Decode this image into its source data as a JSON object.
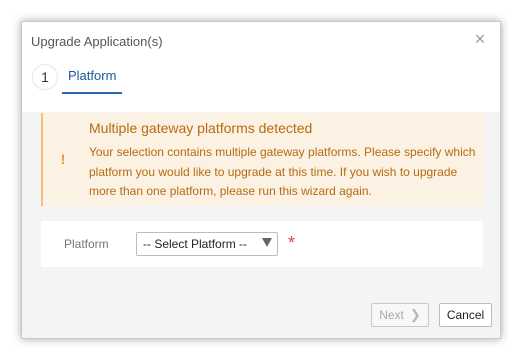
{
  "dialog": {
    "title": "Upgrade Application(s)",
    "close_icon": "close-icon"
  },
  "wizard": {
    "step_number": "1",
    "step_label": "Platform"
  },
  "alert": {
    "icon": "exclamation-icon",
    "title": "Multiple gateway platforms detected",
    "message": "Your selection contains multiple gateway platforms. Please specify which platform you would like to upgrade at this time. If you wish to upgrade more than one platform, please run this wizard again.",
    "color_text": "#b66b12",
    "color_bg": "#fbf2e3"
  },
  "form": {
    "platform_label": "Platform",
    "platform_select_value": "-- Select Platform --",
    "required_marker": "*"
  },
  "buttons": {
    "next_label": "Next",
    "next_icon": "chevron-right-icon",
    "cancel_label": "Cancel"
  }
}
